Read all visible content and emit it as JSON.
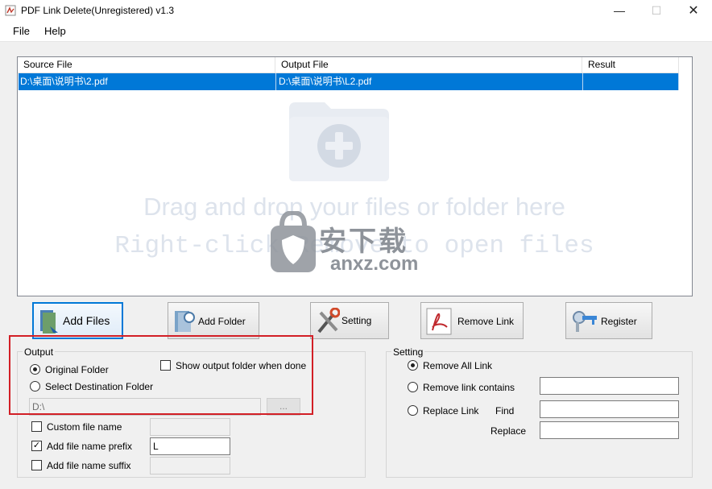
{
  "window": {
    "title": "PDF Link Delete(Unregistered) v1.3",
    "minimize": "—",
    "maximize": "☐",
    "close": "✕"
  },
  "menu": {
    "file": "File",
    "help": "Help"
  },
  "table": {
    "headers": [
      "Source File",
      "Output File",
      "Result"
    ],
    "rows": [
      {
        "source": "D:\\桌面\\说明书\\2.pdf",
        "output": "D:\\桌面\\说明书\\L2.pdf",
        "result": ""
      }
    ],
    "drop_hint_1": "Drag and drop your files or folder here",
    "drop_hint_2": "Right-click Remove to open files"
  },
  "watermark": {
    "cn": "安下载",
    "en": "anxz.com"
  },
  "toolbar": {
    "add_files": "Add Files",
    "add_folder": "Add Folder",
    "setting": "Setting",
    "remove_link": "Remove Link",
    "register": "Register"
  },
  "output": {
    "legend": "Output",
    "original_folder": "Original Folder",
    "select_destination": "Select Destination Folder",
    "show_output_folder": "Show output folder when done",
    "destination_value": "D:\\",
    "browse": "...",
    "custom_file_name": "Custom file name",
    "add_prefix": "Add file name prefix",
    "prefix_value": "L",
    "add_suffix": "Add file name suffix"
  },
  "setting": {
    "legend": "Setting",
    "remove_all": "Remove All Link",
    "remove_contains": "Remove link contains",
    "replace_link": "Replace Link",
    "find": "Find",
    "replace": "Replace"
  },
  "colors": {
    "selection": "#0078d7",
    "highlight_box": "#d21f26"
  }
}
